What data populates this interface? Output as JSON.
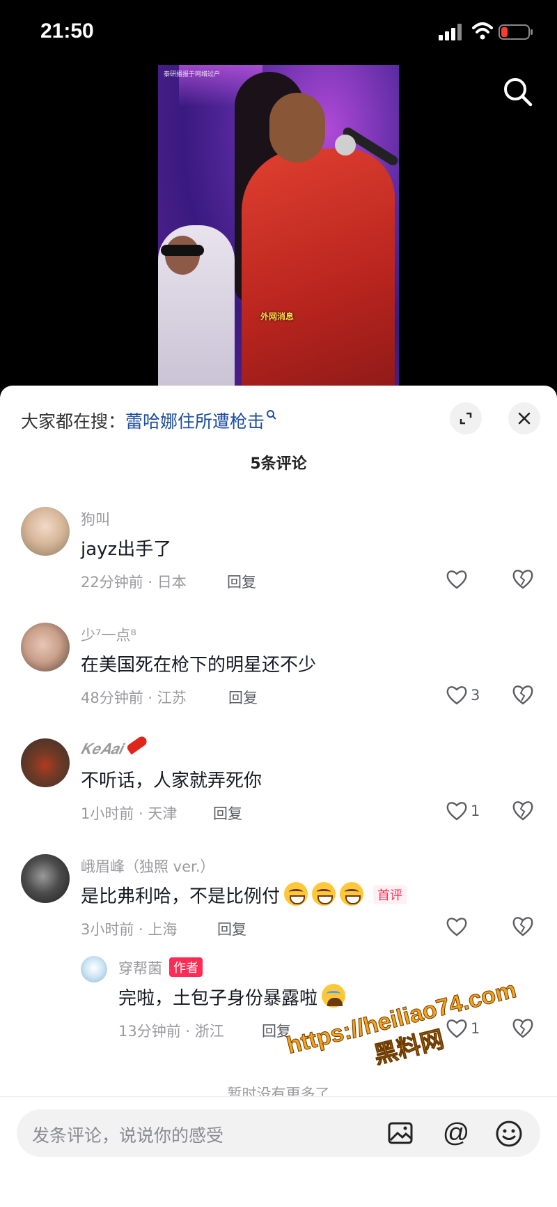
{
  "status_bar": {
    "time": "21:50"
  },
  "video": {
    "watermark_text": "泰研播报于网络过户",
    "caption": "外网消息"
  },
  "sheet": {
    "trend_prefix": "大家都在搜：",
    "trend_query": "蕾哈娜住所遭枪击",
    "comment_count": "5条评论",
    "load_more": "暂时没有更多了"
  },
  "comments": [
    {
      "username": "狗叫",
      "text": "jayz出手了",
      "meta": "22分钟前 · 日本",
      "reply": "回复",
      "likes": ""
    },
    {
      "username": "少⁷一点⁸",
      "text": "在美国死在枪下的明星还不少",
      "meta": "48分钟前 · 江苏",
      "reply": "回复",
      "likes": "3"
    },
    {
      "username": "𝑲𝒆𝑨𝒂𝒊",
      "text": "不听话，人家就弄死你",
      "meta": "1小时前 · 天津",
      "reply": "回复",
      "likes": "1"
    },
    {
      "username": "峨眉峰（独照 ver.）",
      "text": "是比弗利哈，不是比例付",
      "meta": "3小时前 · 上海",
      "reply": "回复",
      "likes": "",
      "badge": "首评"
    }
  ],
  "reply_comment": {
    "username": "穿帮菌",
    "badge": "作者",
    "text": "完啦，土包子身份暴露啦",
    "meta": "13分钟前 · 浙江",
    "reply": "回复",
    "likes": "1"
  },
  "input": {
    "placeholder": "发条评论，说说你的感受"
  },
  "at_symbol": "@",
  "watermark": {
    "url": "https://heiliao74.com",
    "name": "黑料网"
  },
  "colors": {
    "link": "#1f4e9e",
    "accent": "#fe2c55",
    "watermark": "#f6a21a"
  },
  "icons": [
    "search-icon",
    "expand-icon",
    "close-icon",
    "heart-icon",
    "broken-heart-icon",
    "image-icon",
    "emoji-icon"
  ]
}
